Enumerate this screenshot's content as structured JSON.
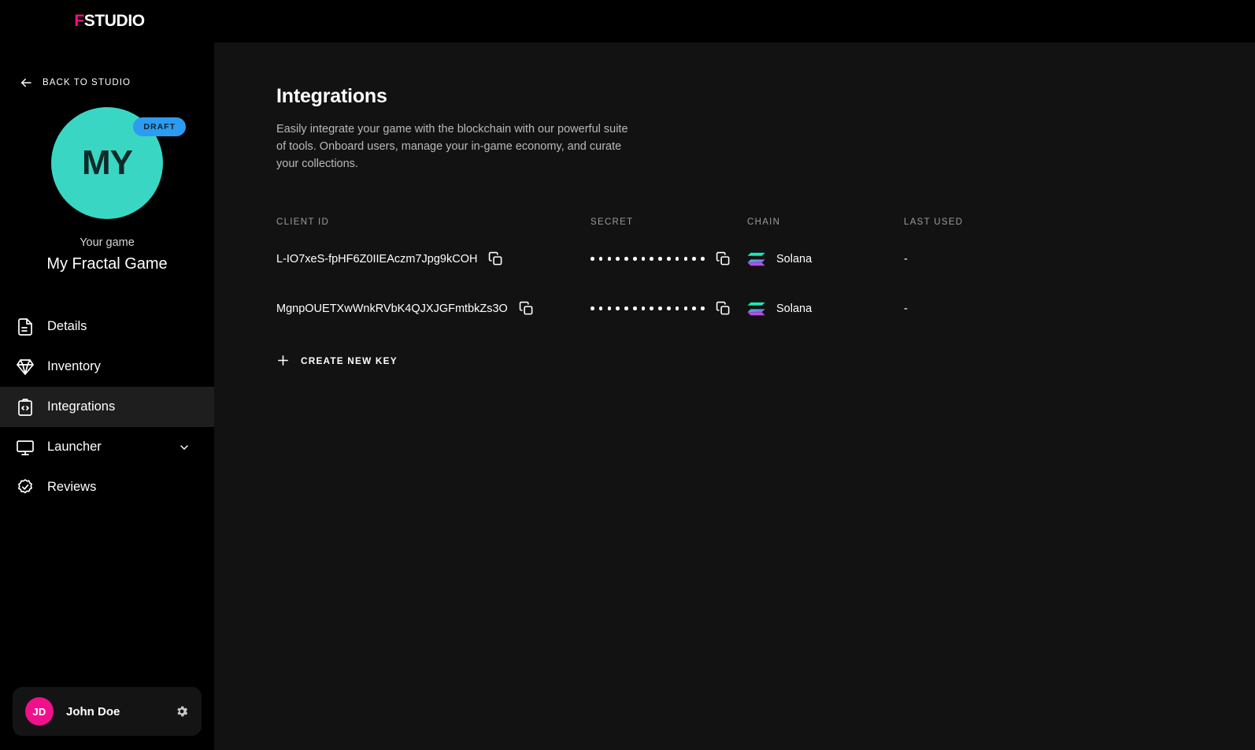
{
  "brand": {
    "prefix": "F",
    "rest": "STUDIO",
    "accent": "#f0108c"
  },
  "sidebar": {
    "back_label": "BACK TO STUDIO",
    "game": {
      "initials": "MY",
      "badge": "DRAFT",
      "eyebrow": "Your game",
      "name": "My Fractal Game",
      "avatar_color": "#3ad6c4",
      "badge_color": "#2d9cf0"
    },
    "items": [
      {
        "label": "Details",
        "icon": "document-icon",
        "active": false
      },
      {
        "label": "Inventory",
        "icon": "gem-icon",
        "active": false
      },
      {
        "label": "Integrations",
        "icon": "code-clipboard-icon",
        "active": true
      },
      {
        "label": "Launcher",
        "icon": "monitor-icon",
        "active": false,
        "expandable": true
      },
      {
        "label": "Reviews",
        "icon": "badge-check-icon",
        "active": false
      }
    ],
    "user": {
      "initials": "JD",
      "name": "John Doe",
      "avatar_color": "#f0108c"
    }
  },
  "main": {
    "title": "Integrations",
    "description": "Easily integrate your game with the blockchain with our powerful suite of tools. Onboard users, manage your in-game economy, and curate your collections.",
    "table": {
      "columns": [
        "CLIENT ID",
        "SECRET",
        "CHAIN",
        "LAST USED"
      ],
      "rows": [
        {
          "client_id": "L-IO7xeS-fpHF6Z0IIEAczm7Jpg9kCOH",
          "secret_masked": "••••••••••••••",
          "secret_dot_count": 14,
          "chain": "Solana",
          "last_used": "-"
        },
        {
          "client_id": "MgnpOUETXwWnkRVbK4QJXJGFmtbkZs3O",
          "secret_masked": "••••••••••••••",
          "secret_dot_count": 14,
          "chain": "Solana",
          "last_used": "-"
        }
      ]
    },
    "create_key_label": "CREATE NEW KEY"
  }
}
